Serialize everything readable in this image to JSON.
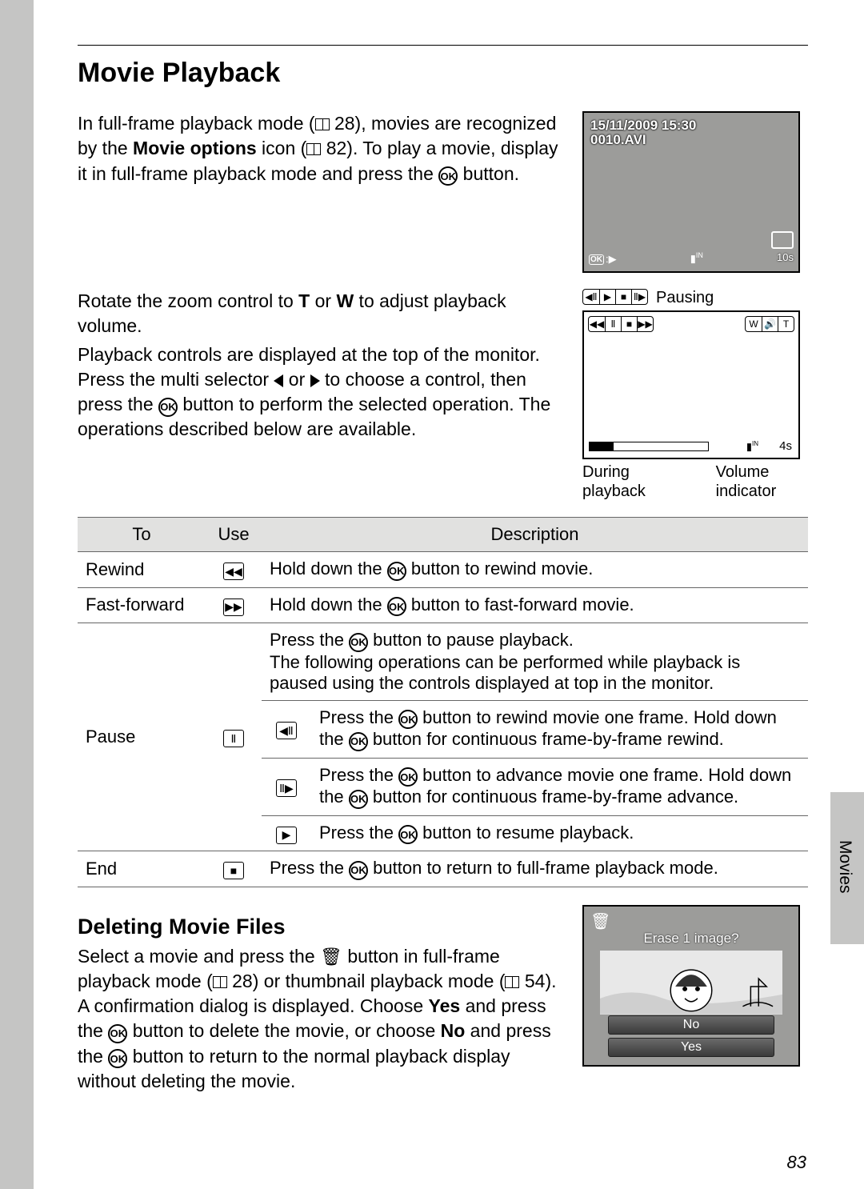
{
  "sideTab": "Movies",
  "pageNumber": "83",
  "heading": "Movie Playback",
  "intro": {
    "part1": "In full-frame playback mode (",
    "ref1": "28), movies are recognized by the ",
    "bold1": "Movie options",
    "part2": " icon (",
    "ref2": "82). To play a movie, display it in full-frame playback mode and press the ",
    "part3": " button."
  },
  "zoomPara1a": "Rotate the zoom control to ",
  "zoomT": "T",
  "zoomOr": " or ",
  "zoomW": "W",
  "zoomPara1b": " to adjust playback volume.",
  "paraControls1": "Playback controls are displayed at the top of the monitor. Press the multi selector ",
  "paraControlsOr": " or ",
  "paraControls2": " to choose a control, then press the ",
  "paraControls3": " button to perform the selected operation. The operations described below are available.",
  "fig1": {
    "date": "15/11/2009 15:30",
    "file": "0010.AVI",
    "dur": "10s"
  },
  "figPausing": "Pausing",
  "fig2time": "4s",
  "figDuring": "During playback",
  "figVolume": "Volume indicator",
  "tbl": {
    "h1": "To",
    "h2": "Use",
    "h3": "Description",
    "r1to": "Rewind",
    "r1desc1": "Hold down the ",
    "r1desc2": " button to rewind movie.",
    "r2to": "Fast-forward",
    "r2desc1": "Hold down the ",
    "r2desc2": " button to fast-forward movie.",
    "r3to": "Pause",
    "r3d1a": "Press the ",
    "r3d1b": " button to pause playback.",
    "r3d1c": "The following operations can be performed while playback is paused using the controls displayed at top in the monitor.",
    "r3d2a": "Press the ",
    "r3d2b": " button to rewind movie one frame. Hold down the ",
    "r3d2c": " button for continuous frame-by-frame rewind.",
    "r3d3a": "Press the ",
    "r3d3b": " button to advance movie one frame. Hold down the ",
    "r3d3c": " button for continuous frame-by-frame advance.",
    "r3d4a": "Press the ",
    "r3d4b": " button to resume playback.",
    "r4to": "End",
    "r4d1": "Press the ",
    "r4d2": " button to return to full-frame playback mode."
  },
  "del": {
    "heading": "Deleting Movie Files",
    "p1": "Select a movie and press the ",
    "p2": " button in full-frame playback mode (",
    "ref1": "28) or thumbnail playback mode (",
    "ref2": "54). A confirmation dialog is displayed. Choose ",
    "yes": "Yes",
    "p3": " and press the ",
    "p4": " button to delete the movie, or choose ",
    "no": "No",
    "p5": " and press the ",
    "p6": " button to return to the normal playback display without deleting the movie."
  },
  "dialog": {
    "title": "Erase 1 image?",
    "no": "No",
    "yes": "Yes"
  }
}
